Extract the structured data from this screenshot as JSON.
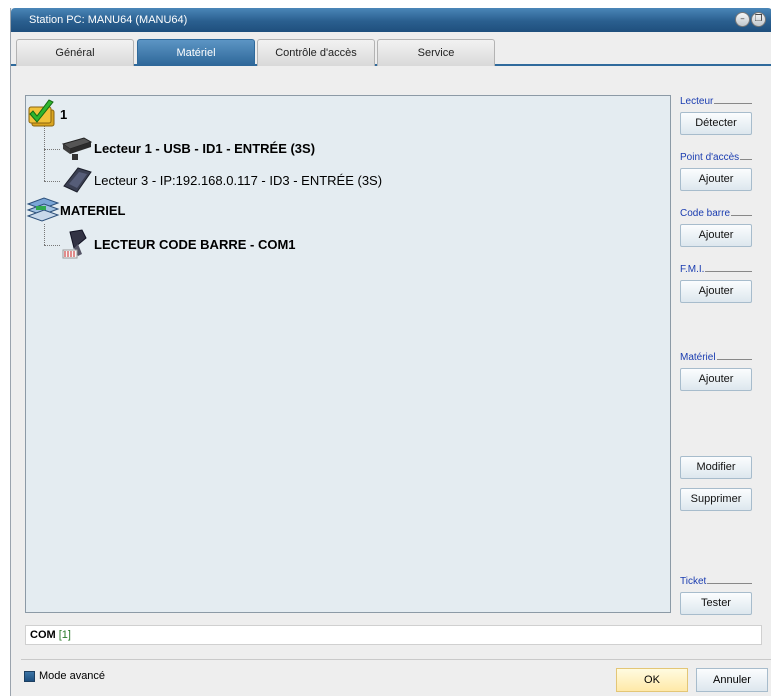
{
  "window": {
    "title": "Station PC: MANU64 (MANU64)",
    "minimize_glyph": "–",
    "restore_glyph": "❐"
  },
  "tabs": [
    {
      "label": "Général",
      "active": false
    },
    {
      "label": "Matériel",
      "active": true
    },
    {
      "label": "Contrôle d'accès",
      "active": false
    },
    {
      "label": "Service",
      "active": false
    }
  ],
  "tree": {
    "group1": {
      "label": "1",
      "icon": "checkmark-folder-icon",
      "children": [
        {
          "label": "Lecteur 1 - USB - ID1 - ENTRÉE (3S)",
          "icon": "usb-reader-icon"
        },
        {
          "label": "Lecteur 3 - IP:192.168.0.117 - ID3 - ENTRÉE (3S)",
          "icon": "ip-reader-icon"
        }
      ]
    },
    "group2": {
      "label": "MATERIEL",
      "icon": "hardware-stack-icon",
      "children": [
        {
          "label": "LECTEUR CODE BARRE - COM1",
          "icon": "barcode-scanner-icon"
        }
      ]
    }
  },
  "side_panel": {
    "lecteur": {
      "label": "Lecteur",
      "button": "Détecter"
    },
    "point_acces": {
      "label": "Point d'accès",
      "button": "Ajouter"
    },
    "code_barre": {
      "label": "Code barre",
      "button": "Ajouter"
    },
    "fmi": {
      "label": "F.M.I.",
      "button": "Ajouter"
    },
    "materiel": {
      "label": "Matériel",
      "button": "Ajouter"
    },
    "modifier": "Modifier",
    "supprimer": "Supprimer",
    "ticket": {
      "label": "Ticket",
      "button": "Tester"
    }
  },
  "status": {
    "key": "COM",
    "value": "[1]"
  },
  "footer": {
    "mode_label": "Mode avancé",
    "ok": "OK",
    "cancel": "Annuler"
  },
  "colors": {
    "accent": "#2f6a9c",
    "tree_bg": "#e4ecf1",
    "group_label": "#1a3cb0",
    "ok_bg": "#ffe9a8"
  }
}
